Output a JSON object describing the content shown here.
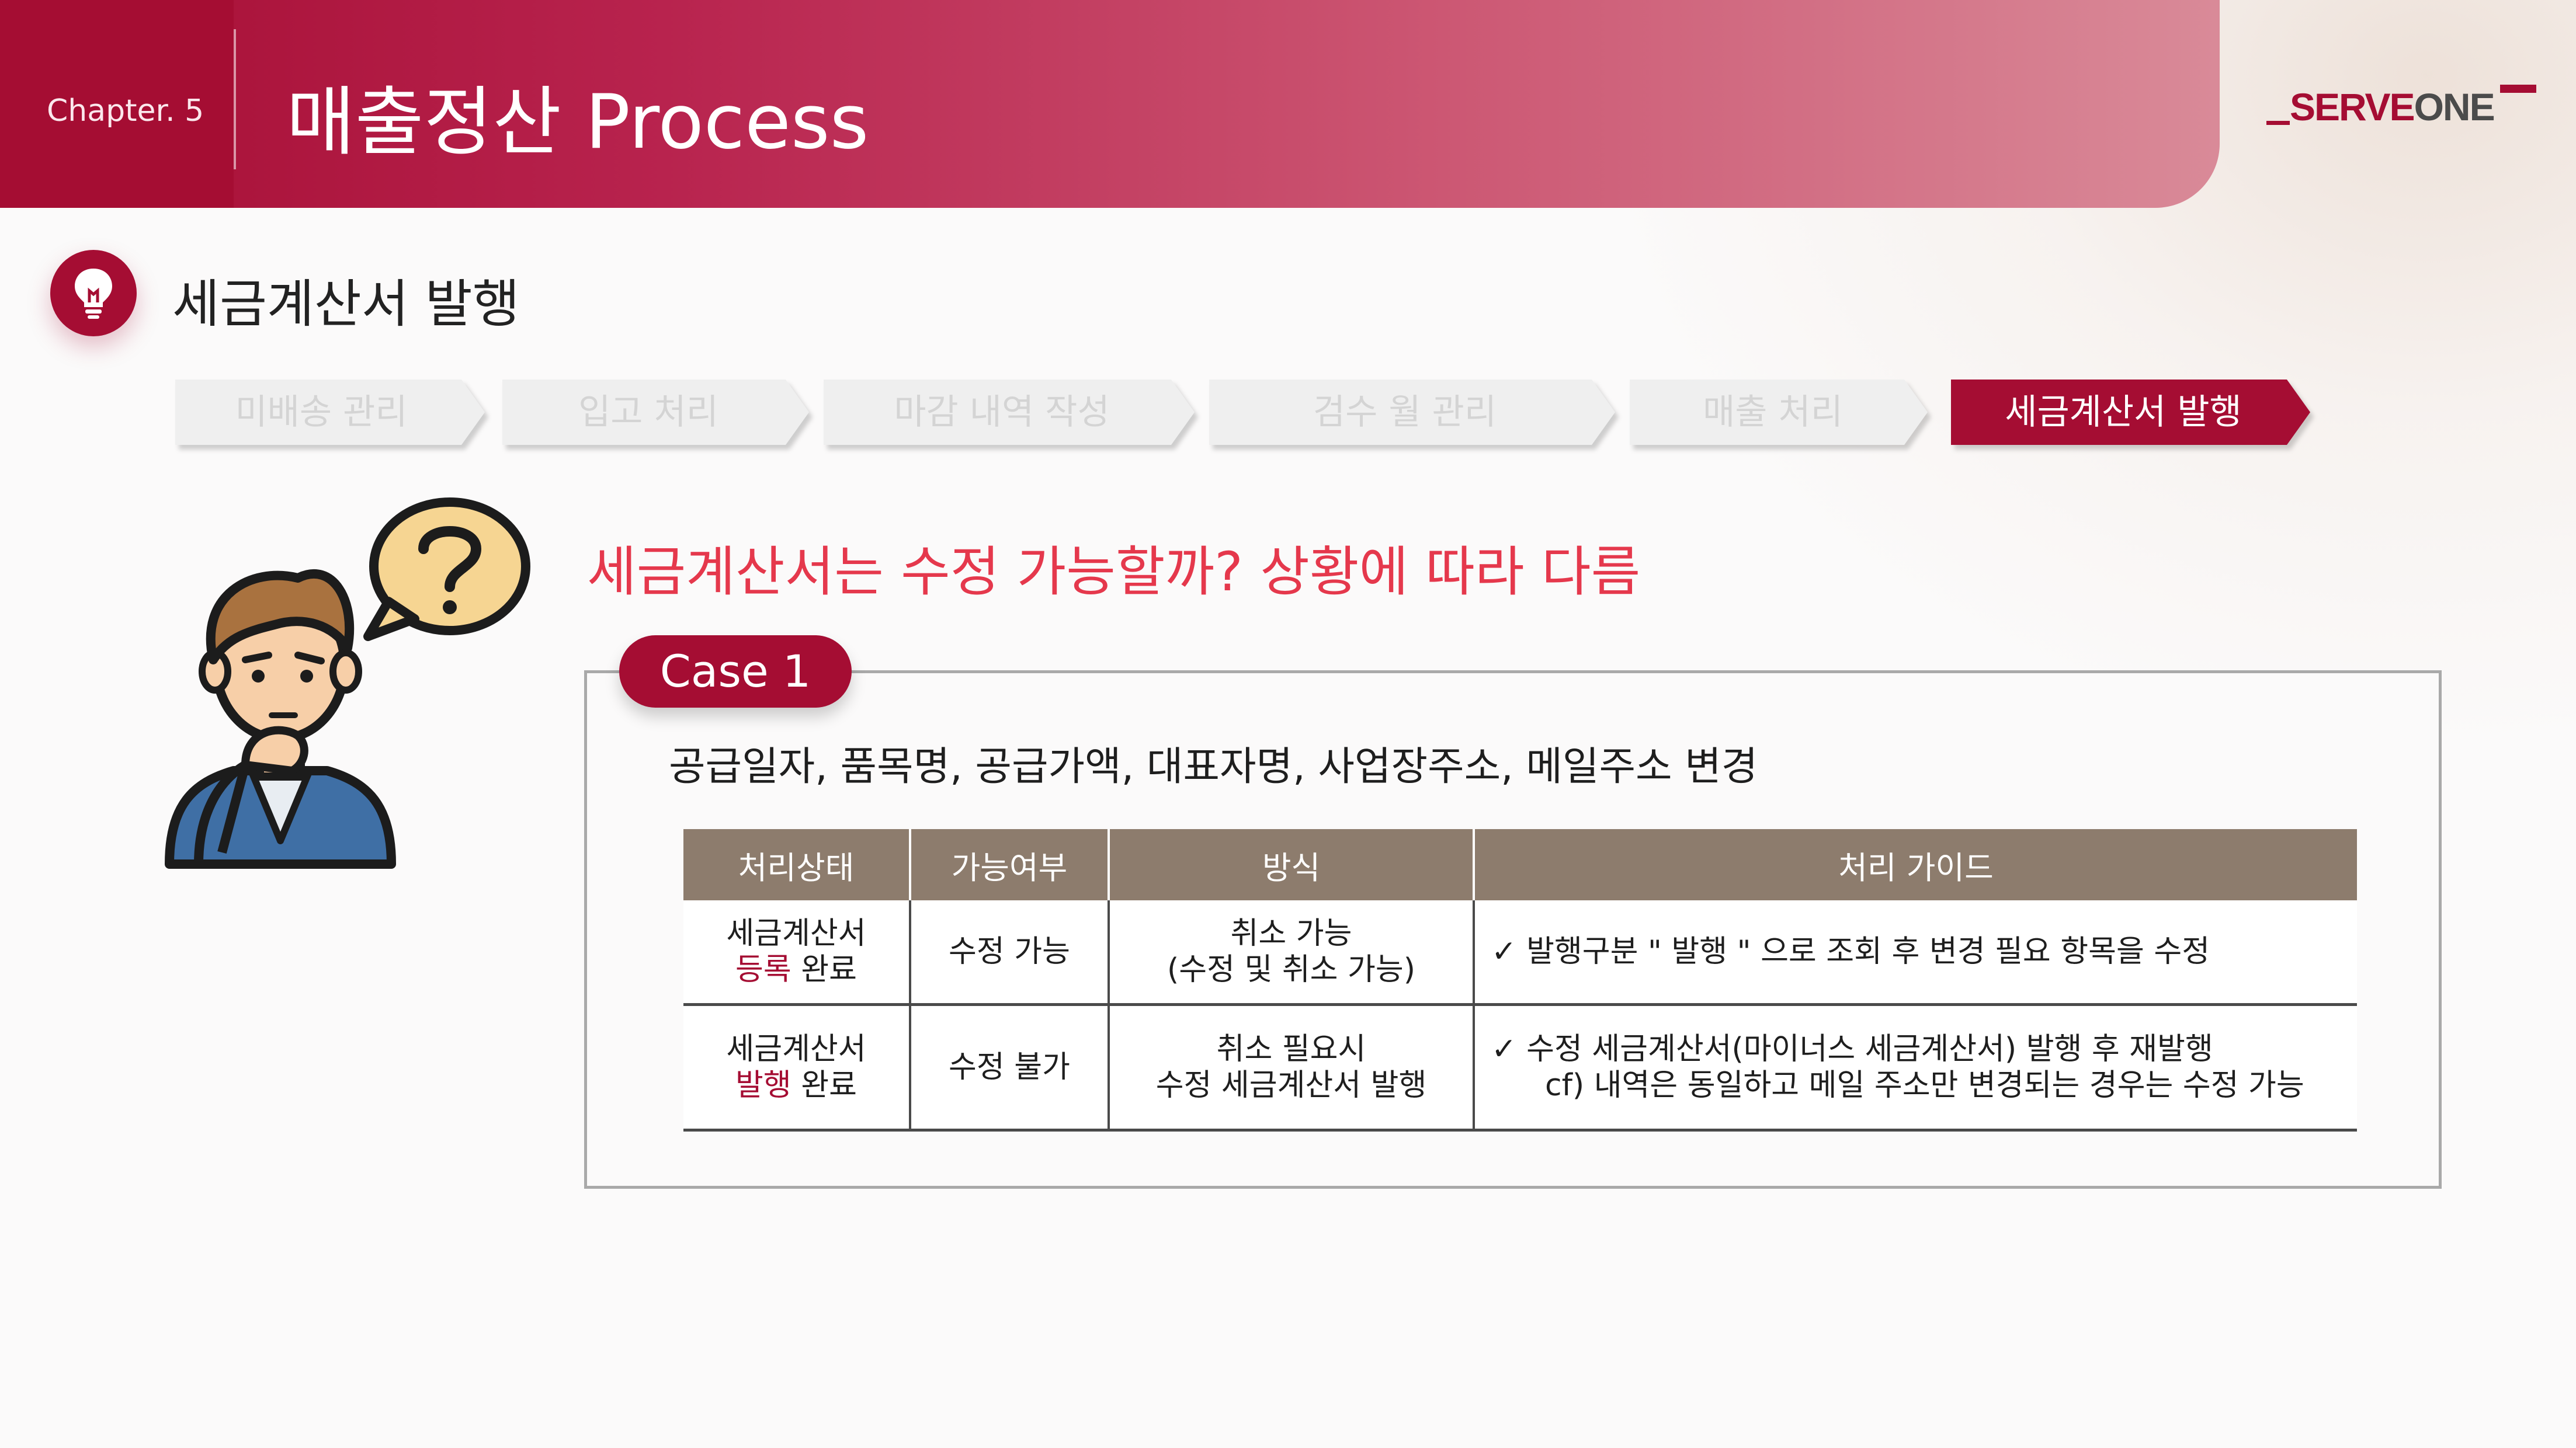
{
  "header": {
    "chapter": "Chapter. 5",
    "title": "매출정산 Process",
    "logo_text_main": "SERVE",
    "logo_text_end": "ONE"
  },
  "section": {
    "title": "세금계산서 발행",
    "icon": "lightbulb-icon"
  },
  "process_steps": [
    {
      "label": "미배송 관리",
      "active": false
    },
    {
      "label": "입고 처리",
      "active": false
    },
    {
      "label": "마감 내역 작성",
      "active": false
    },
    {
      "label": "검수 월 관리",
      "active": false
    },
    {
      "label": "매출 처리",
      "active": false
    },
    {
      "label": "세금계산서 발행",
      "active": true
    }
  ],
  "question": "세금계산서는 수정 가능할까?  상황에 따라 다름",
  "case": {
    "tab_label": "Case 1",
    "description": "공급일자, 품목명, 공급가액, 대표자명, 사업장주소, 메일주소 변경",
    "table": {
      "headers": [
        "처리상태",
        "가능여부",
        "방식",
        "처리 가이드"
      ],
      "rows": [
        {
          "status_line1": "세금계산서",
          "status_highlight": "등록",
          "status_rest": " 완료",
          "possible": "수정 가능",
          "method_line1": "취소 가능",
          "method_line2": "(수정 및 취소 가능)",
          "guide_line1": "✓ 발행구분 \" 발행 \" 으로 조회 후 변경 필요 항목을 수정",
          "guide_line2": ""
        },
        {
          "status_line1": "세금계산서",
          "status_highlight": "발행",
          "status_rest": " 완료",
          "possible": "수정 불가",
          "method_line1": "취소 필요시",
          "method_line2": "수정 세금계산서 발행",
          "guide_line1": "✓ 수정 세금계산서(마이너스 세금계산서) 발행 후 재발행",
          "guide_line2": "cf) 내역은 동일하고 메일 주소만 변경되는 경우는 수정 가능"
        }
      ]
    }
  },
  "colors": {
    "brand": "#a50d33",
    "question_text": "#e5384c",
    "table_header": "#8d7c6d",
    "inactive_step": "#efefef"
  }
}
